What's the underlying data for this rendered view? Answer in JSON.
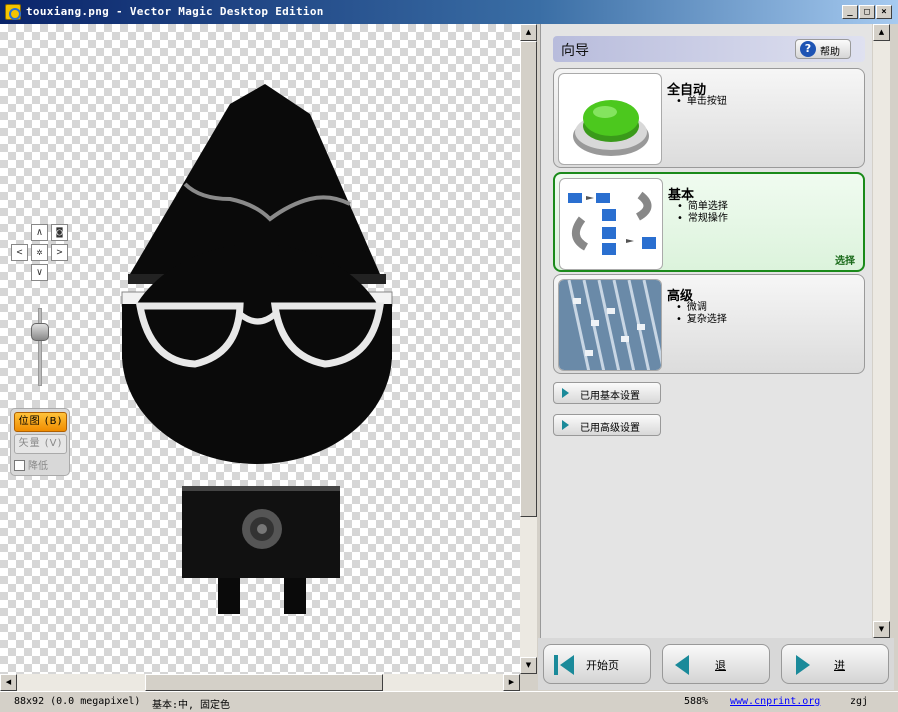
{
  "window": {
    "title": "touxiang.png - Vector Magic Desktop Edition",
    "controls": [
      "_",
      "□",
      "×"
    ]
  },
  "canvas_tools": {
    "pan_up": "∧",
    "pan_down": "∨",
    "pan_left": "<",
    "pan_right": ">",
    "pan_center": "✲",
    "fit_label": "◙",
    "mode_bitmap": "位图 (B)",
    "mode_vector": "矢量 (V)",
    "mode_smooth": "降低"
  },
  "wizard": {
    "title": "向导",
    "help_label": "帮助",
    "options": [
      {
        "title": "全自动",
        "bullets": [
          "单击按钮"
        ],
        "selected": false,
        "icon": "green-button-icon"
      },
      {
        "title": "基本",
        "bullets": [
          "简单选择",
          "常规操作"
        ],
        "selected": true,
        "select_label": "选择",
        "icon": "workflow-icon"
      },
      {
        "title": "高级",
        "bullets": [
          "微调",
          "复杂选择"
        ],
        "selected": false,
        "icon": "mixer-icon"
      }
    ],
    "preset_basic": "已用基本设置",
    "preset_advanced": "已用高级设置"
  },
  "bottom_nav": {
    "home_label": "开始页",
    "back_label": "退",
    "next_label": "进"
  },
  "status": {
    "image_info": "88x92 (0.0 megapixel)",
    "mode_info": "基本:中, 固定色",
    "zoom": "588%",
    "link": "www.cnprint.org",
    "user": "zgj"
  },
  "colors": {
    "title_bar": "#0a246a",
    "bitmap_active": "#f08c00",
    "selected_option_border": "#1a8a1a",
    "help_icon": "#1e54b4"
  }
}
